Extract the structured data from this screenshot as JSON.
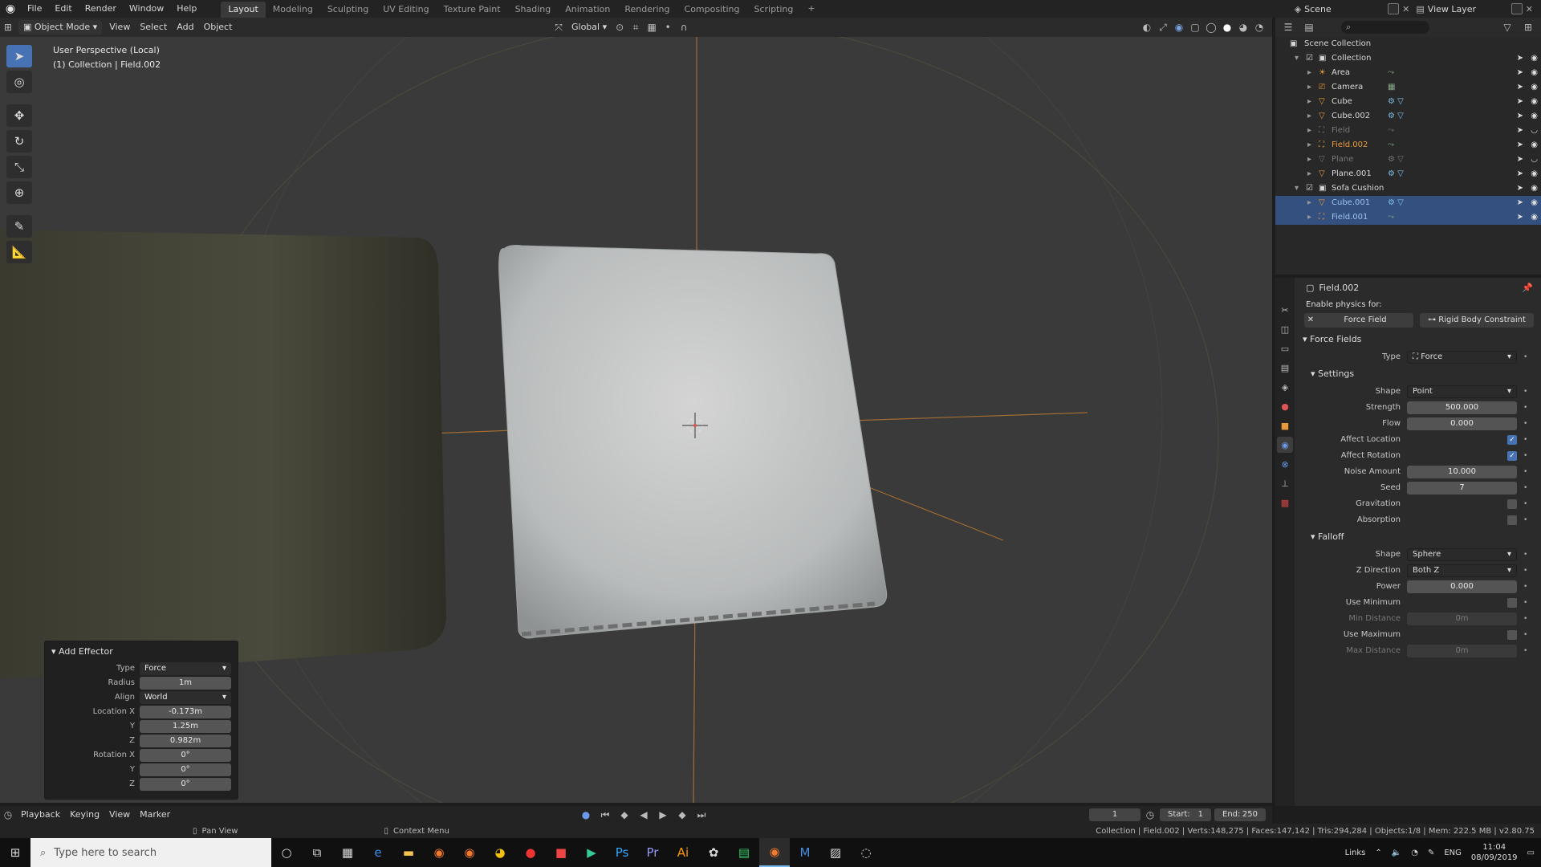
{
  "top_menu": [
    "File",
    "Edit",
    "Render",
    "Window",
    "Help"
  ],
  "workspaces": [
    {
      "label": "Layout",
      "active": true
    },
    {
      "label": "Modeling",
      "active": false
    },
    {
      "label": "Sculpting",
      "active": false
    },
    {
      "label": "UV Editing",
      "active": false
    },
    {
      "label": "Texture Paint",
      "active": false
    },
    {
      "label": "Shading",
      "active": false
    },
    {
      "label": "Animation",
      "active": false
    },
    {
      "label": "Rendering",
      "active": false
    },
    {
      "label": "Compositing",
      "active": false
    },
    {
      "label": "Scripting",
      "active": false
    }
  ],
  "add_workspace": "+",
  "scene": "Scene",
  "view_layer": "View Layer",
  "viewport_header": {
    "mode": "Object Mode",
    "menus": [
      "View",
      "Select",
      "Add",
      "Object"
    ],
    "transform_orientation": "Global"
  },
  "viewport_info": {
    "line1": "User Perspective (Local)",
    "line2": "(1) Collection | Field.002"
  },
  "tools": [
    "select",
    "cursor",
    "move",
    "rotate",
    "scale",
    "transform",
    "annotate",
    "measure"
  ],
  "add_effector": {
    "title": "Add Effector",
    "rows": [
      {
        "label": "Type",
        "value": "Force",
        "kind": "dropdown"
      },
      {
        "label": "Radius",
        "value": "1m",
        "kind": "field"
      },
      {
        "label": "Align",
        "value": "World",
        "kind": "dropdown"
      },
      {
        "label": "Location X",
        "value": "-0.173m",
        "kind": "field"
      },
      {
        "label": "Y",
        "value": "1.25m",
        "kind": "field"
      },
      {
        "label": "Z",
        "value": "0.982m",
        "kind": "field"
      },
      {
        "label": "Rotation X",
        "value": "0°",
        "kind": "field"
      },
      {
        "label": "Y",
        "value": "0°",
        "kind": "field"
      },
      {
        "label": "Z",
        "value": "0°",
        "kind": "field"
      }
    ]
  },
  "timeline": {
    "menus": [
      "Playback",
      "Keying",
      "View",
      "Marker"
    ],
    "current_frame": "1",
    "start_label": "Start:",
    "start": "1",
    "end_label": "End:",
    "end": "250"
  },
  "statusbar": {
    "pan": "Pan View",
    "context": "Context Menu",
    "stats": "Collection | Field.002 | Verts:148,275 | Faces:147,142 | Tris:294,284 | Objects:1/8 | Mem: 222.5 MB | v2.80.75"
  },
  "outliner": {
    "root": "Scene Collection",
    "rows": [
      {
        "name": "Collection",
        "indent": 1,
        "type": "collection",
        "expanded": true,
        "dim": false,
        "sel": false
      },
      {
        "name": "Area",
        "indent": 2,
        "type": "light",
        "dim": false,
        "sel": false
      },
      {
        "name": "Camera",
        "indent": 2,
        "type": "camera",
        "dim": false,
        "sel": false
      },
      {
        "name": "Cube",
        "indent": 2,
        "type": "mesh",
        "dim": false,
        "sel": false
      },
      {
        "name": "Cube.002",
        "indent": 2,
        "type": "mesh",
        "dim": false,
        "sel": false
      },
      {
        "name": "Field",
        "indent": 2,
        "type": "field",
        "dim": true,
        "sel": false
      },
      {
        "name": "Field.002",
        "indent": 2,
        "type": "field",
        "dim": false,
        "sel": false,
        "active": true
      },
      {
        "name": "Plane",
        "indent": 2,
        "type": "mesh",
        "dim": true,
        "sel": false
      },
      {
        "name": "Plane.001",
        "indent": 2,
        "type": "mesh",
        "dim": false,
        "sel": false
      },
      {
        "name": "Sofa Cushion",
        "indent": 1,
        "type": "collection",
        "expanded": true,
        "dim": false,
        "sel": false
      },
      {
        "name": "Cube.001",
        "indent": 2,
        "type": "mesh",
        "dim": false,
        "sel": true
      },
      {
        "name": "Field.001",
        "indent": 2,
        "type": "field",
        "dim": false,
        "sel": true
      }
    ]
  },
  "properties": {
    "object": "Field.002",
    "enable_physics_label": "Enable physics for:",
    "physics_buttons": [
      "Force Field",
      "Rigid Body Constraint"
    ],
    "force_fields_title": "Force Fields",
    "type_label": "Type",
    "type_value": "Force",
    "settings_title": "Settings",
    "settings": [
      {
        "label": "Shape",
        "value": "Point",
        "kind": "dropdown"
      },
      {
        "label": "Strength",
        "value": "500.000",
        "kind": "field"
      },
      {
        "label": "Flow",
        "value": "0.000",
        "kind": "field"
      },
      {
        "label": "Affect Location",
        "value": "",
        "kind": "check",
        "on": true
      },
      {
        "label": "Affect Rotation",
        "value": "",
        "kind": "check",
        "on": true
      },
      {
        "label": "Noise Amount",
        "value": "10.000",
        "kind": "field"
      },
      {
        "label": "Seed",
        "value": "7",
        "kind": "field"
      },
      {
        "label": "Gravitation",
        "value": "",
        "kind": "check",
        "on": false
      },
      {
        "label": "Absorption",
        "value": "",
        "kind": "check",
        "on": false
      }
    ],
    "falloff_title": "Falloff",
    "falloff": [
      {
        "label": "Shape",
        "value": "Sphere",
        "kind": "dropdown"
      },
      {
        "label": "Z Direction",
        "value": "Both Z",
        "kind": "dropdown"
      },
      {
        "label": "Power",
        "value": "0.000",
        "kind": "field"
      },
      {
        "label": "Use Minimum",
        "value": "",
        "kind": "check",
        "on": false
      },
      {
        "label": "Min Distance",
        "value": "0m",
        "kind": "field",
        "disabled": true
      },
      {
        "label": "Use Maximum",
        "value": "",
        "kind": "check",
        "on": false
      },
      {
        "label": "Max Distance",
        "value": "0m",
        "kind": "field",
        "disabled": true
      }
    ]
  },
  "taskbar": {
    "search_placeholder": "Type here to search",
    "apps": [
      "cortana",
      "task-view",
      "calculator",
      "edge",
      "file-explorer",
      "blender-a",
      "blender-b",
      "chrome",
      "app-red-a",
      "app-red-b",
      "play",
      "photoshop",
      "premiere",
      "illustrator",
      "app-color",
      "app-green",
      "blender-active",
      "app-m",
      "photos",
      "app-circle"
    ],
    "links": "Links",
    "lang": "ENG",
    "time": "11:04",
    "date": "08/09/2019"
  },
  "colors": {
    "accent": "#4772b3",
    "selection": "#33507f",
    "active_object": "#e89a3a",
    "viewport_bg": "#3a3a3a"
  }
}
